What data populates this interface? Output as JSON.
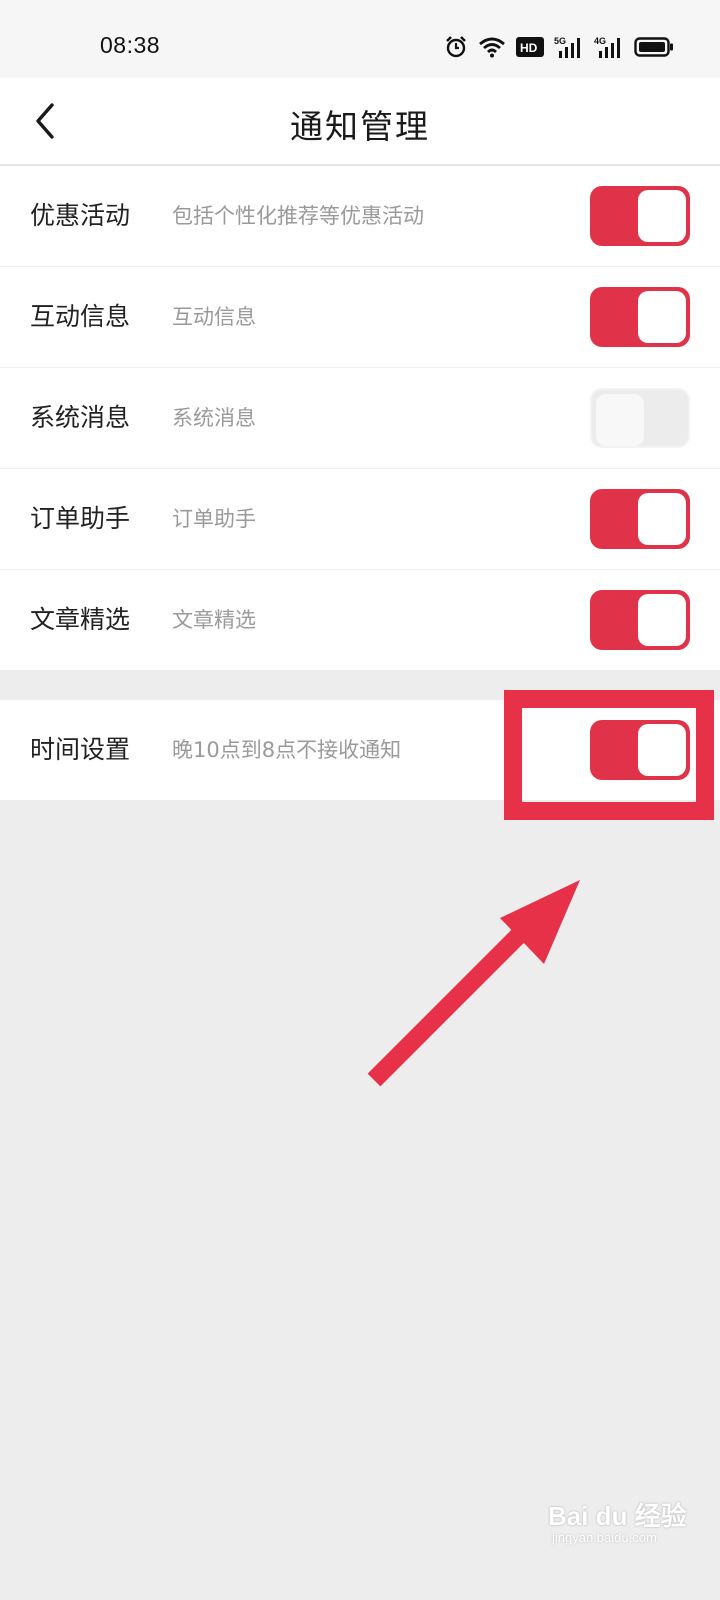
{
  "status_bar": {
    "time": "08:38",
    "icons": [
      "alarm-icon",
      "wifi-icon",
      "hd-icon",
      "5g-signal-icon",
      "4g-signal-icon",
      "battery-icon"
    ],
    "hd_label": "HD",
    "net1_label": "5G",
    "net2_label": "4G"
  },
  "header": {
    "title": "通知管理",
    "back_icon": "chevron-left-icon"
  },
  "items": [
    {
      "title": "优惠活动",
      "desc": "包括个性化推荐等优惠活动",
      "enabled": true
    },
    {
      "title": "互动信息",
      "desc": "互动信息",
      "enabled": true
    },
    {
      "title": "系统消息",
      "desc": "系统消息",
      "enabled": false
    },
    {
      "title": "订单助手",
      "desc": "订单助手",
      "enabled": true
    },
    {
      "title": "文章精选",
      "desc": "文章精选",
      "enabled": true
    }
  ],
  "time_setting": {
    "title": "时间设置",
    "desc": "晚10点到8点不接收通知",
    "enabled": true
  },
  "annotation": {
    "color": "#e63148"
  },
  "colors": {
    "accent": "#e03248",
    "toggle_off": "#ececec",
    "background": "#ededed"
  },
  "watermark": {
    "text": "Bai du 经验",
    "sub": "jingyan.baidu.com"
  }
}
